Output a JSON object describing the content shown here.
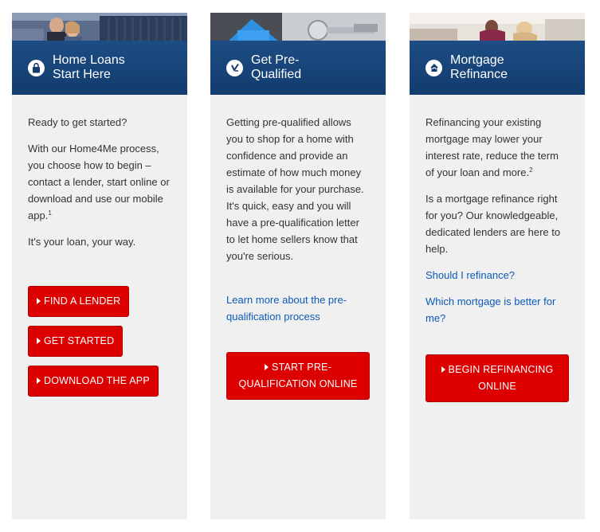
{
  "cards": [
    {
      "title_line1": "Home Loans",
      "title_line2": "Start Here",
      "icon": "lock-icon",
      "paragraphs": [
        "Ready to get started?",
        "With our Home4Me process, you choose how to begin – contact a lender, start online or download and use our mobile app.",
        "It's your loan, your way."
      ],
      "footnote": "1",
      "buttons": [
        "FIND A LENDER",
        "GET STARTED",
        "DOWNLOAD THE APP"
      ]
    },
    {
      "title_line1": "Get Pre-",
      "title_line2": "Qualified",
      "icon": "checklist-icon",
      "paragraphs": [
        "Getting pre-qualified allows you to shop for a home with confidence and provide an estimate of how much money is available for your purchase. It's quick, easy and you will have a pre-qualification letter to let home sellers know that you're serious."
      ],
      "link": "Learn more about the pre-qualification process",
      "button": "START PRE-QUALIFICATION ONLINE"
    },
    {
      "title_line1": "Mortgage",
      "title_line2": "Refinance",
      "icon": "house-refinance-icon",
      "paragraphs": [
        "Refinancing your existing mortgage may lower your interest rate, reduce the term of your loan and more.",
        "Is a mortgage refinance right for you? Our knowledgeable, dedicated lenders are here to help."
      ],
      "footnote": "2",
      "links": [
        "Should I refinance?",
        "Which mortgage is better for me?"
      ],
      "button": "BEGIN REFINANCING ONLINE"
    }
  ],
  "colors": {
    "banner": "#1d4d84",
    "button": "#dc0000",
    "link": "#0c5ab8",
    "card_bg": "#f0f0f0"
  }
}
